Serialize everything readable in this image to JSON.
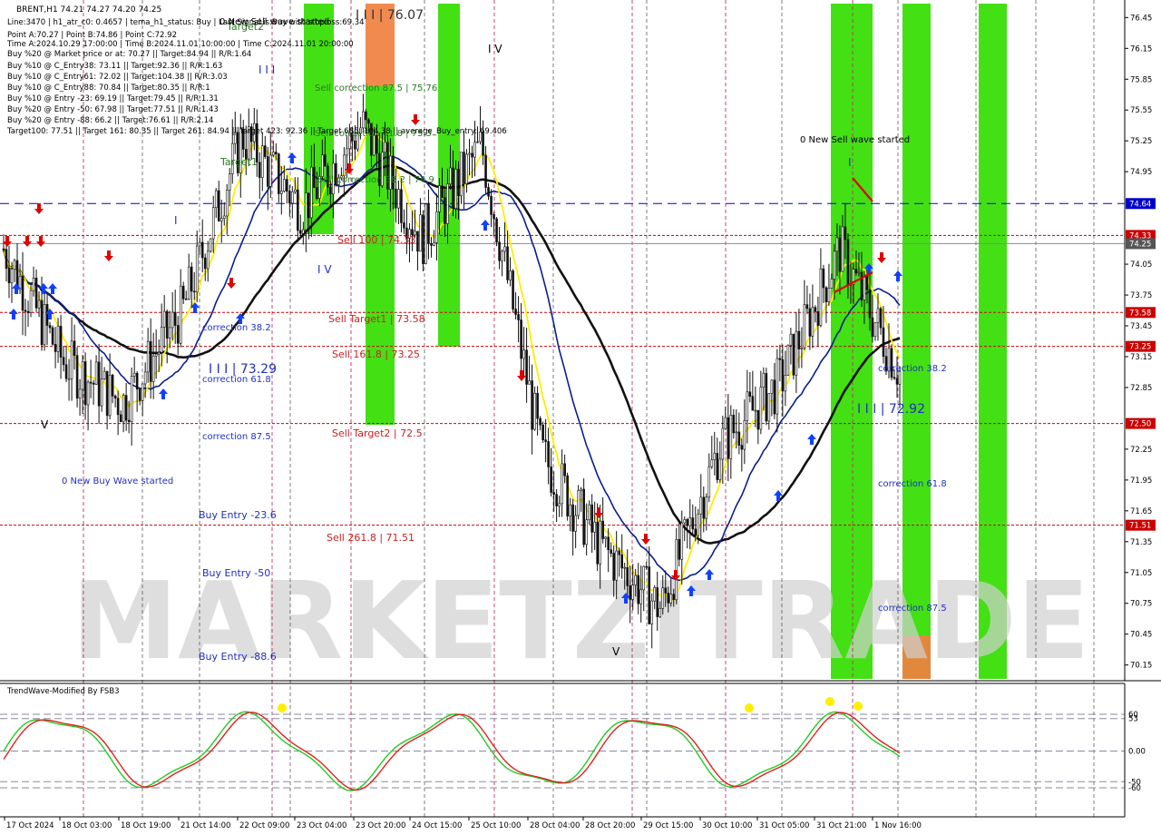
{
  "header": {
    "symbol_line": "BRENT,H1  74.21 74.27 74.20 74.25",
    "info_lines": [
      "Line:3470 | h1_atr_c0: 0.4657 | tema_h1_status: Buy | Last Signal is:Buy with stoploss:69.34",
      "Point A:70.27 | Point B:74.86 | Point C:72.92",
      "Time A:2024.10.29 17:00:00 | Time B:2024.11.01 10:00:00 | Time C:2024.11.01 20:00:00",
      "Buy %20 @ Market price or at: 70.27 || Target:84.94 || R/R:1.64",
      "Buy %10 @ C_Entry38: 73.11 || Target:92.36 || R/R:1.63",
      "Buy %10 @ C_Entry61: 72.02 || Target:104.38 || R/R:3.03",
      "Buy %10 @ C_Entry88: 70.84 || Target:80.35 || R/R:1",
      "Buy %10 @ Entry -23: 69.19 || Target:79.45 || R/R:1.31",
      "Buy %20 @ Entry -50: 67.98 || Target:77.51 || R/R:1.43",
      "Buy %20 @ Entry -88: 66.2 || Target:76.61 || R/R:2.14",
      "Target100: 77.51 || Target 161: 80.35 || Target 261: 84.94 || Target 423: 92.36 || Target 685: 104.38 || average_Buy_entry: 69.406"
    ]
  },
  "colors": {
    "price_line": "#0000cc",
    "level_red": "#cc0000",
    "level_blue": "#0000cc",
    "green_zone": "#33dd00",
    "orange_zone": "#f08040",
    "yellow_ma": "#ffee00",
    "navy_ma": "#0a1f8f",
    "black_ma": "#111111",
    "candle": "#111111"
  },
  "price_axis": {
    "ticks": [
      "76.45",
      "76.15",
      "75.85",
      "75.55",
      "75.25",
      "74.95",
      "74.05",
      "73.75",
      "73.45",
      "73.15",
      "72.85",
      "72.25",
      "71.95",
      "71.65",
      "71.35",
      "71.05",
      "70.75",
      "70.45",
      "70.15"
    ],
    "tick_values": [
      76.45,
      76.15,
      75.85,
      75.55,
      75.25,
      74.95,
      74.05,
      73.75,
      73.45,
      73.15,
      72.85,
      72.25,
      71.95,
      71.65,
      71.35,
      71.05,
      70.75,
      70.45,
      70.15
    ],
    "badges": [
      {
        "label": "74.64",
        "value": 74.64,
        "color": "#0000cc"
      },
      {
        "label": "74.33",
        "value": 74.33,
        "color": "#cc0000"
      },
      {
        "label": "74.25",
        "value": 74.25,
        "color": "#555555"
      },
      {
        "label": "73.58",
        "value": 73.58,
        "color": "#cc0000"
      },
      {
        "label": "73.25",
        "value": 73.25,
        "color": "#cc0000"
      },
      {
        "label": "72.50",
        "value": 72.5,
        "color": "#cc0000"
      },
      {
        "label": "71.51",
        "value": 71.51,
        "color": "#cc0000"
      }
    ],
    "range": [
      70.05,
      76.55
    ]
  },
  "time_axis": {
    "labels": [
      "17 Oct 2024",
      "18 Oct 03:00",
      "18 Oct 19:00",
      "21 Oct 14:00",
      "22 Oct 09:00",
      "23 Oct 04:00",
      "23 Oct 20:00",
      "24 Oct 15:00",
      "25 Oct 10:00",
      "28 Oct 04:00",
      "28 Oct 20:00",
      "29 Oct 15:00",
      "30 Oct 10:00",
      "31 Oct 05:00",
      "31 Oct 21:00",
      "1 Nov 16:00"
    ]
  },
  "annotations": {
    "wave_labels": [
      "V",
      "I",
      "I I I",
      "I V",
      "I V",
      "V",
      "I",
      "I I I | 73.29",
      "I I I | 76.07",
      "I I I | 72.92",
      "I",
      "V"
    ],
    "level_texts": [
      "Sell correction 87.5 | 75.76",
      "Sell correction 61.8 | 75.3",
      "Sell correction 38.2 | 74.9",
      "Sell 100 | 74.33",
      "Sell Target1 | 73.58",
      "Sell 161.8 | 73.25",
      "Sell Target2 | 72.5",
      "Sell 261.8 | 71.51",
      "correction 38.2",
      "correction 61.8",
      "correction 87.5",
      "0 New Buy Wave started",
      "Buy Entry -23.6",
      "Buy Entry -50",
      "Buy Entry -88.6",
      "0 New Sell wave started",
      "correction 38.2",
      "correction 61.8",
      "correction 87.5",
      "Target1",
      "Target2",
      "0 New Sell wave started"
    ],
    "watermark": "MARKETZITRADE"
  },
  "indicator": {
    "title": "TrendWave-Modified By FSB3",
    "ticks": [
      "60",
      "53",
      "0.00",
      "-50",
      "-60"
    ],
    "tick_values": [
      60,
      53,
      0,
      -50,
      -60
    ],
    "range": [
      -100,
      100
    ]
  },
  "chart_data": {
    "type": "line",
    "title": "BRENT,H1",
    "x": [
      "17 Oct 2024",
      "18 Oct 03:00",
      "18 Oct 19:00",
      "21 Oct 14:00",
      "22 Oct 09:00",
      "23 Oct 04:00",
      "23 Oct 20:00",
      "24 Oct 15:00",
      "25 Oct 10:00",
      "28 Oct 04:00",
      "28 Oct 20:00",
      "29 Oct 15:00",
      "30 Oct 10:00",
      "31 Oct 05:00",
      "31 Oct 21:00",
      "1 Nov 16:00"
    ],
    "series": [
      {
        "name": "close",
        "values": [
          74.2,
          73.1,
          72.7,
          73.6,
          75.3,
          74.6,
          75.4,
          74.3,
          75.2,
          72.2,
          71.3,
          70.7,
          72.3,
          72.9,
          74.2,
          73.0
        ]
      }
    ],
    "ylim": [
      70.05,
      76.55
    ]
  }
}
